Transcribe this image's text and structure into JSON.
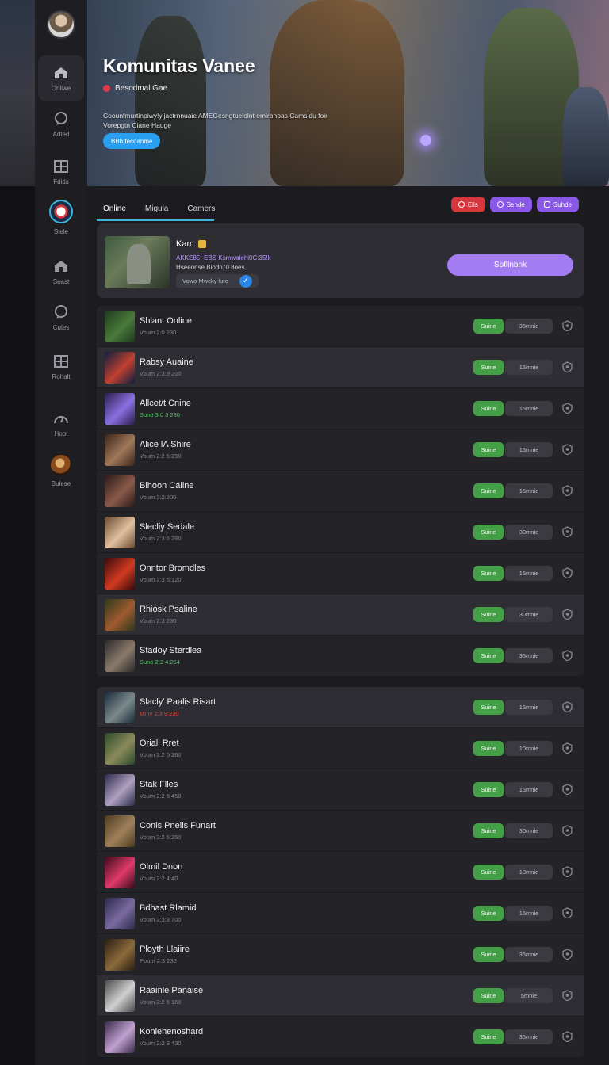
{
  "hero": {
    "title": "Komunitas Vanee",
    "subtitle": "Besodmal Gae",
    "description": "Coounfmurtinpiwy!yijactrnnuaie AMEGesngtuelolnt emirbnoas Camsldu foir Vorepgtn Ciane Hauge",
    "button_label": "BBb fecdanme"
  },
  "sidebar": {
    "items": [
      {
        "label": "Onliwe",
        "icon": "home-icon"
      },
      {
        "label": "Adted",
        "icon": "chat-icon"
      },
      {
        "label": "Fdids",
        "icon": "grid-icon"
      },
      {
        "label": "Stele",
        "icon": "community-avatar"
      },
      {
        "label": "Seast",
        "icon": "home-icon"
      },
      {
        "label": "Cules",
        "icon": "chat-icon"
      },
      {
        "label": "Rohalt",
        "icon": "grid-icon"
      },
      {
        "label": "Hoot",
        "icon": "gauge-icon"
      },
      {
        "label": "Bulese",
        "icon": "user-avatar"
      }
    ]
  },
  "tabs": [
    "Online",
    "Migula",
    "Camers"
  ],
  "chips": [
    {
      "label": "Eils",
      "color": "#d7363c"
    },
    {
      "label": "Sende",
      "color": "#8a58e6"
    },
    {
      "label": "Suhde",
      "color": "#8a58e6"
    }
  ],
  "feature": {
    "name": "Kam",
    "line1": "AKKE85 -EBS Ksmwalehi0C:35!k",
    "line2": "Hseeonse Biodn,'0 8oes",
    "tag": "Vowo Mwcky luro",
    "cta": "Sofllnbnk"
  },
  "list1": [
    {
      "title": "Shlant Online",
      "sub": "Voum 2:0 230",
      "sub_color": "grey",
      "status": "Suine",
      "time": "35mnie",
      "thumb": [
        "#1e3a1e",
        "#4a7a3a"
      ]
    },
    {
      "title": "Rabsy Auaine",
      "sub": "Voum 2:3:9 200",
      "sub_color": "grey",
      "status": "Suine",
      "time": "15mnie",
      "thumb": [
        "#0e1e3e",
        "#c04030"
      ]
    },
    {
      "title": "Allcet/t Cnine",
      "sub": "Suno 3:0 3 230",
      "sub_color": "green",
      "status": "Suine",
      "time": "15mnie",
      "thumb": [
        "#2a1e4e",
        "#8a70e0"
      ]
    },
    {
      "title": "Alice lA Shire",
      "sub": "Voum 2:2 5:250",
      "sub_color": "grey",
      "status": "Suine",
      "time": "15mnie",
      "thumb": [
        "#3a2418",
        "#a0785a"
      ]
    },
    {
      "title": "Bihoon Caline",
      "sub": "Voum 2:2:200",
      "sub_color": "grey",
      "status": "Suine",
      "time": "15mnie",
      "thumb": [
        "#2a1a18",
        "#8a5a4a"
      ]
    },
    {
      "title": "Slecliy Sedale",
      "sub": "Voum 2:3:6 260",
      "sub_color": "grey",
      "status": "Suine",
      "time": "30mnie",
      "thumb": [
        "#6a4a30",
        "#e0c0a0"
      ]
    },
    {
      "title": "Onntor Bromdles",
      "sub": "Voum 2:3 5:120",
      "sub_color": "grey",
      "status": "Suine",
      "time": "15mnie",
      "thumb": [
        "#3a0a0a",
        "#d03a20"
      ]
    },
    {
      "title": "Rhiosk Psaline",
      "sub": "Voum 2:3 230",
      "sub_color": "grey",
      "status": "Suine",
      "time": "30mnie",
      "thumb": [
        "#2a3a1a",
        "#a05a30"
      ]
    },
    {
      "title": "Stadoy Sterdlea",
      "sub": "Suno 2:2 4:254",
      "sub_color": "green",
      "status": "Suine",
      "time": "35mnie",
      "thumb": [
        "#2a2a2a",
        "#8a7a6a"
      ]
    }
  ],
  "list2": [
    {
      "title": "Slacly' Paalis Risart",
      "sub": "Mmy 2:3 9:230",
      "sub_color": "red",
      "status": "Suine",
      "time": "15mnie",
      "thumb": [
        "#1a2a3a",
        "#7a8a8a"
      ]
    },
    {
      "title": "Oriall Rret",
      "sub": "Voum 2:2 6 260",
      "sub_color": "grey",
      "status": "Suine",
      "time": "10mnie",
      "thumb": [
        "#2a4a2a",
        "#8a8a5a"
      ]
    },
    {
      "title": "Stak Flles",
      "sub": "Voum 2:2 5 450",
      "sub_color": "grey",
      "status": "Suine",
      "time": "15mnie",
      "thumb": [
        "#2a2a4a",
        "#b0a0c0"
      ]
    },
    {
      "title": "Conls Pnelis Funart",
      "sub": "Voum 2:2 5:250",
      "sub_color": "grey",
      "status": "Suine",
      "time": "30mnie",
      "thumb": [
        "#4a3a20",
        "#a0805a"
      ]
    },
    {
      "title": "Olmil Dnon",
      "sub": "Voum 2:2 4:40",
      "sub_color": "grey",
      "status": "Suine",
      "time": "10mnie",
      "thumb": [
        "#3a0a1a",
        "#e03a6a"
      ]
    },
    {
      "title": "Bdhast Rlamid",
      "sub": "Voum 2:3:3 700",
      "sub_color": "grey",
      "status": "Suine",
      "time": "15mnie",
      "thumb": [
        "#2a2a4a",
        "#7a6aa0"
      ]
    },
    {
      "title": "Ployth Llaiire",
      "sub": "Poum 2:3 230",
      "sub_color": "grey",
      "status": "Suine",
      "time": "35mnie",
      "thumb": [
        "#2a1e14",
        "#8a6a3a"
      ]
    },
    {
      "title": "Raainle Panaise",
      "sub": "Voum 2:2 5 160",
      "sub_color": "grey",
      "status": "Suine",
      "time": "5mnie",
      "thumb": [
        "#4a4a4a",
        "#d0d0d0"
      ]
    },
    {
      "title": "Koniehenoshard",
      "sub": "Voum 2:2 3 430",
      "sub_color": "grey",
      "status": "Suine",
      "time": "35mnie",
      "thumb": [
        "#3a2a4a",
        "#c0a0d0"
      ]
    }
  ]
}
